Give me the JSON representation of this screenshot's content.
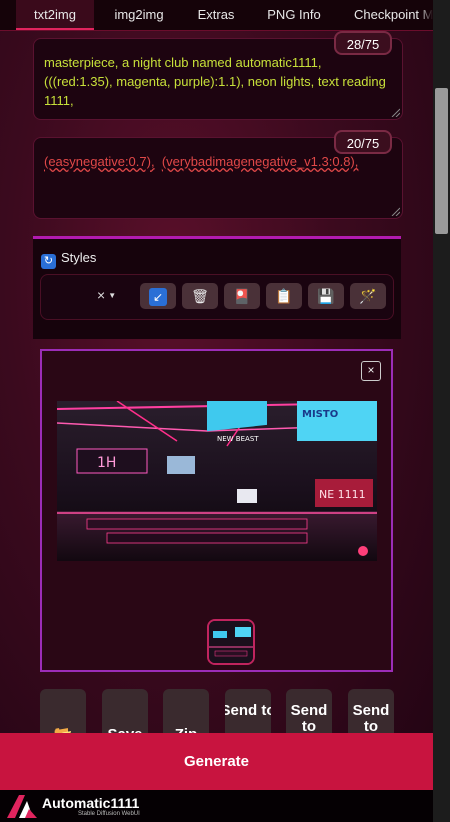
{
  "tabs": [
    {
      "label": "txt2img",
      "active": true
    },
    {
      "label": "img2img"
    },
    {
      "label": "Extras"
    },
    {
      "label": "PNG Info"
    },
    {
      "label": "Checkpoint M"
    }
  ],
  "prompt": {
    "positive_text": "masterpiece, a night club named automatic1111, (((red:1.35), magenta, purple):1.1), neon lights, text reading 1111,",
    "positive_counter": "28/75",
    "negative_part1": "(easynegative:0.7),",
    "negative_part2": "(verybadimagenegative_v1.3:0.8),",
    "negative_counter": "20/75"
  },
  "styles": {
    "label": "Styles",
    "clear_glyph": "×",
    "buttons": [
      {
        "icon": "arrow-down-left-icon",
        "glyph": "↙"
      },
      {
        "icon": "trash-icon",
        "glyph": "🗑"
      },
      {
        "icon": "card-icon",
        "glyph": "🎴"
      },
      {
        "icon": "clipboard-icon",
        "glyph": "📋"
      },
      {
        "icon": "save-icon",
        "glyph": "💾"
      },
      {
        "icon": "magic-wand-icon",
        "glyph": "🪄"
      }
    ]
  },
  "gallery": {
    "close_glyph": "×",
    "image_text_1": "1H",
    "image_text_2": "NE 1111"
  },
  "actions": [
    {
      "label": "📂"
    },
    {
      "label": "Save"
    },
    {
      "label": "Zip"
    },
    {
      "label": "Send to"
    },
    {
      "label": "Send to"
    },
    {
      "label": "Send to"
    }
  ],
  "generate_label": "Generate",
  "footer": {
    "title": "Automatic1111",
    "subtitle": "Stable Diffusion WebUI"
  },
  "colors": {
    "accent": "#c8143f",
    "border_accent": "#9c2db7"
  }
}
